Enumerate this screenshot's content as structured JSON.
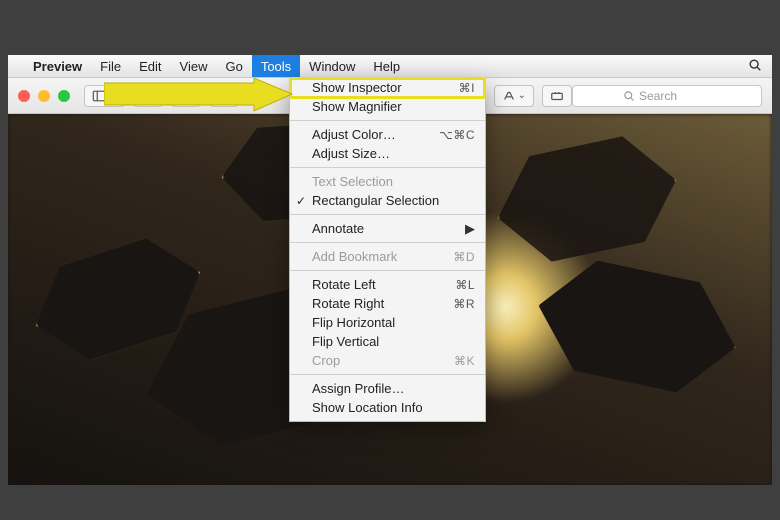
{
  "menubar": {
    "app": "Preview",
    "items": [
      "File",
      "Edit",
      "View",
      "Go",
      "Tools",
      "Window",
      "Help"
    ],
    "selected": "Tools"
  },
  "toolbar": {
    "search_placeholder": "Search"
  },
  "dropdown": {
    "sections": [
      [
        {
          "label": "Show Inspector",
          "shortcut": "⌘I",
          "highlighted": true
        },
        {
          "label": "Show Magnifier"
        }
      ],
      [
        {
          "label": "Adjust Color…",
          "shortcut": "⌥⌘C"
        },
        {
          "label": "Adjust Size…"
        }
      ],
      [
        {
          "label": "Text Selection",
          "disabled": true
        },
        {
          "label": "Rectangular Selection",
          "checked": true
        }
      ],
      [
        {
          "label": "Annotate",
          "submenu": true
        }
      ],
      [
        {
          "label": "Add Bookmark",
          "shortcut": "⌘D",
          "disabled": true
        }
      ],
      [
        {
          "label": "Rotate Left",
          "shortcut": "⌘L"
        },
        {
          "label": "Rotate Right",
          "shortcut": "⌘R"
        },
        {
          "label": "Flip Horizontal"
        },
        {
          "label": "Flip Vertical"
        },
        {
          "label": "Crop",
          "shortcut": "⌘K",
          "disabled": true
        }
      ],
      [
        {
          "label": "Assign Profile…"
        },
        {
          "label": "Show Location Info"
        }
      ]
    ]
  },
  "annotation": {
    "arrow_color": "#e9dd1f"
  }
}
